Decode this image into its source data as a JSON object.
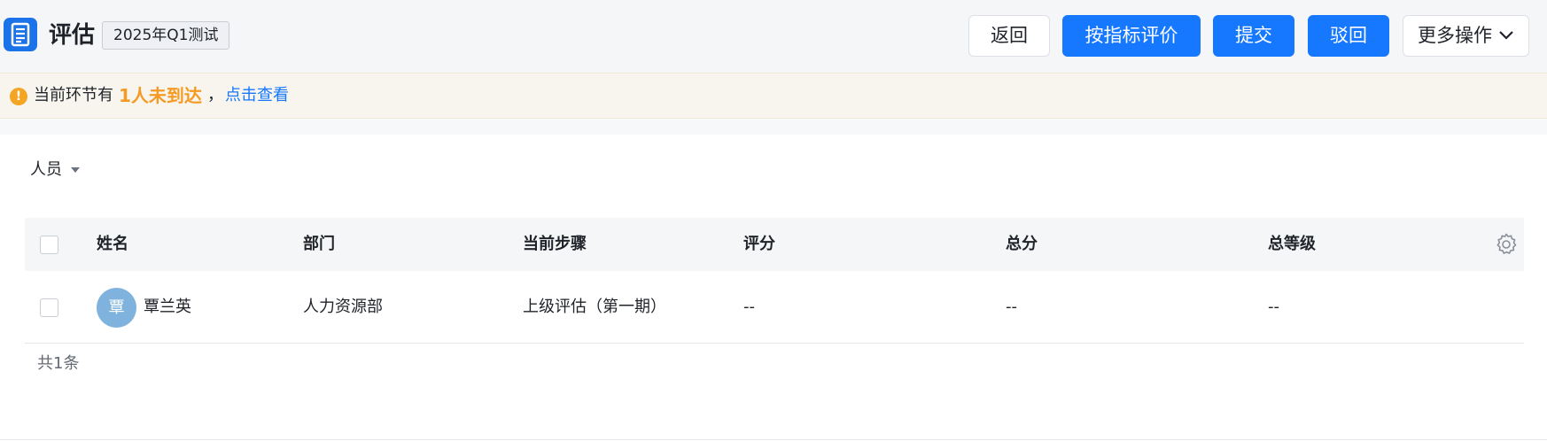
{
  "header": {
    "title": "评估",
    "tag": "2025年Q1测试",
    "buttons": {
      "back": "返回",
      "evaluate_by_indicator": "按指标评价",
      "submit": "提交",
      "reject": "驳回",
      "more_actions": "更多操作"
    }
  },
  "alert": {
    "prefix": "当前环节有",
    "highlight": "1人未到达",
    "comma": "，",
    "link": "点击查看",
    "icon": "exclamation-circle-icon"
  },
  "filter": {
    "label": "人员"
  },
  "table": {
    "columns": [
      "姓名",
      "部门",
      "当前步骤",
      "评分",
      "总分",
      "总等级"
    ],
    "rows": [
      {
        "avatar_char": "覃",
        "name": "覃兰英",
        "department": "人力资源部",
        "step": "上级评估（第一期）",
        "score": "--",
        "total": "--",
        "grade": "--"
      }
    ],
    "total_text": "共1条"
  },
  "colors": {
    "primary": "#1677ff",
    "warning": "#f59a23",
    "avatar": "#7fb3dd"
  }
}
